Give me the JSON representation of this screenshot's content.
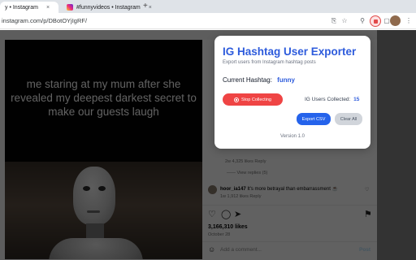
{
  "browser": {
    "tabs": [
      {
        "label": "y • Instagram",
        "active": true
      },
      {
        "label": "#funnyvideos • Instagram",
        "active": false
      }
    ],
    "close_symbol": "×",
    "new_tab_symbol": "+",
    "url": "instagram.com/p/DBotOYjIgRF/",
    "toolbar_icons": [
      "install-icon",
      "star-icon",
      "extensions-icon",
      "sidebar-icon",
      "profile-avatar",
      "menu-icon"
    ]
  },
  "post": {
    "meme_text": "me staring at my mum after she revealed my deepest darkest secret to make our guests laugh",
    "comment1_meta": "2w   4,325 likes   Reply",
    "view_replies": "View replies (5)",
    "comment2_user": "hoor_ia147",
    "comment2_text": "It's more betrayal than embarrassment ☕",
    "comment2_meta": "1w   1,912 likes   Reply",
    "likes": "3,166,310 likes",
    "date": "October 28",
    "add_comment_placeholder": "Add a comment...",
    "post_label": "Post"
  },
  "popup": {
    "title": "IG Hashtag User Exporter",
    "subtitle": "Export users from Instagram hashtag posts",
    "hashtag_label": "Current Hashtag:",
    "hashtag_value": "funny",
    "stop_label": "Stop Collecting",
    "collected_label": "IG Users Collected:",
    "collected_count": "15",
    "export_label": "Export CSV",
    "clear_label": "Clear All",
    "version": "Version 1.0"
  },
  "colors": {
    "accent": "#2d5bdc",
    "stop_red": "#ef4444",
    "export_blue": "#2563eb"
  }
}
